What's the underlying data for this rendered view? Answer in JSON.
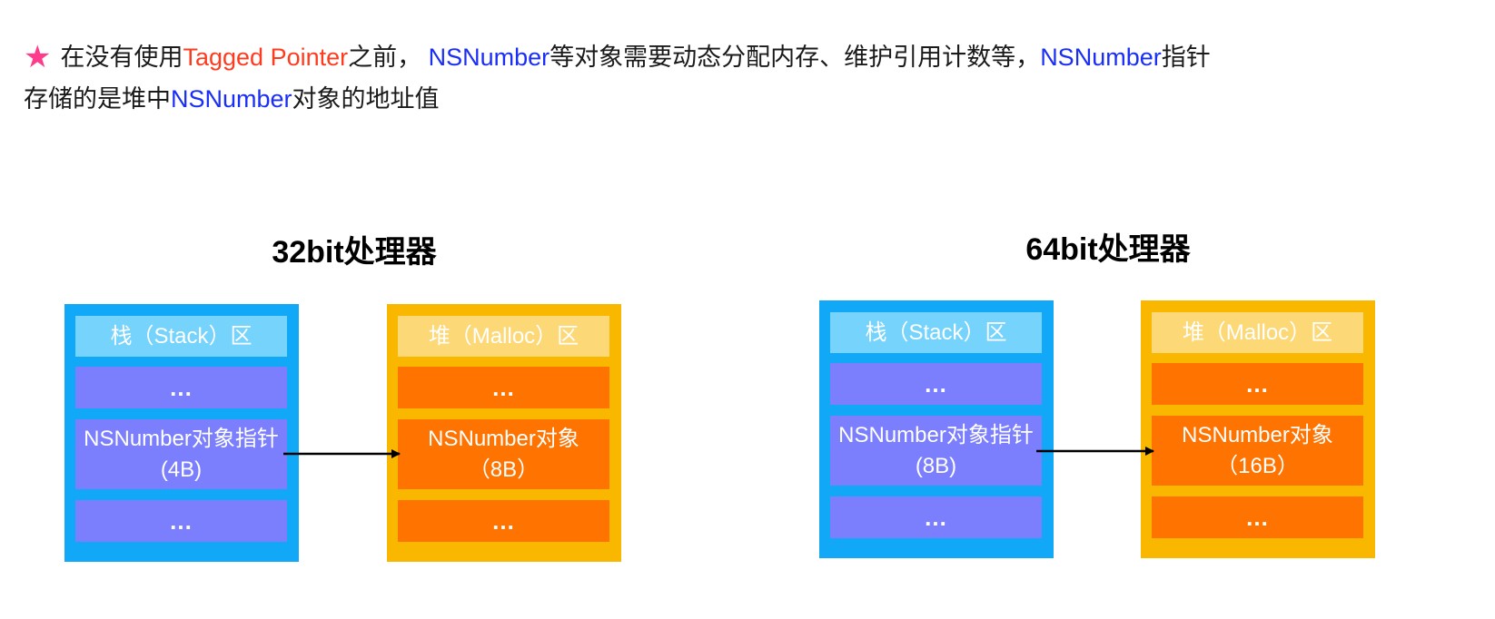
{
  "intro": {
    "star_icon": "star-icon",
    "p1": "在没有使用",
    "tagged_pointer": "Tagged Pointer",
    "p2": "之前，",
    "nsnumber_1": "NSNumber",
    "p3": "等对象需要动态分配内存、维护引用计数等，",
    "nsnumber_2": "NSNumber",
    "p4": "指针",
    "p5": "存储的是堆中",
    "nsnumber_3": "NSNumber",
    "p6": "对象的地址值"
  },
  "diagrams": [
    {
      "title": "32bit处理器",
      "stack": {
        "header": "栈（Stack）区",
        "top_dots": "...",
        "pointer_label": "NSNumber对象指针",
        "pointer_size": "(4B)",
        "bottom_dots": "..."
      },
      "heap": {
        "header": "堆（Malloc）区",
        "top_dots": "...",
        "object_label": "NSNumber对象",
        "object_size": "（8B）",
        "bottom_dots": "..."
      }
    },
    {
      "title": "64bit处理器",
      "stack": {
        "header": "栈（Stack）区",
        "top_dots": "...",
        "pointer_label": "NSNumber对象指针",
        "pointer_size": "(8B)",
        "bottom_dots": "..."
      },
      "heap": {
        "header": "堆（Malloc）区",
        "top_dots": "...",
        "object_label": "NSNumber对象",
        "object_size": "（16B）",
        "bottom_dots": "..."
      }
    }
  ],
  "colors": {
    "star": "#ff3b8b",
    "highlight_red": "#ff3b1f",
    "highlight_blue": "#1a2ef5",
    "stack_border": "#12a8f8",
    "stack_header": "#75d3fc",
    "stack_row": "#7b7ffe",
    "heap_border": "#fab700",
    "heap_header": "#fcd877",
    "heap_row": "#ff7300"
  }
}
